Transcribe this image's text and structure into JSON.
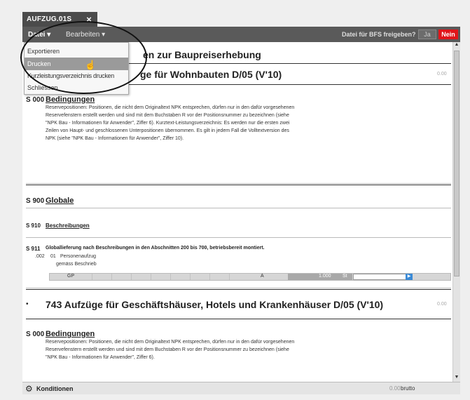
{
  "window": {
    "tab_title": "AUFZUG.01S",
    "tab_close": "×"
  },
  "menubar": {
    "file_menu": "Datei ▾",
    "edit_menu": "Bearbeiten ▾",
    "release_question": "Datei für BFS freigeben?",
    "yes_label": "Ja",
    "no_label": "Nein"
  },
  "dropdown": {
    "items": [
      {
        "label": "Exportieren"
      },
      {
        "label": "Drucken"
      },
      {
        "label": "Kurzleistungsverzeichnis drucken"
      },
      {
        "label": "Schliessen"
      }
    ],
    "active_item": "Drucken"
  },
  "document": {
    "header_partial": "en zur Baupreiserhebung",
    "chapter1_title_partial": "ge für Wohnbauten D/05 (V'10)",
    "chapter1_version": "0.00",
    "s000_code": "S 000",
    "s000_title": "Bedingungen",
    "s000_text": "Reservepositionen: Positionen, die nicht dem Originaltext NPK entsprechen, dürfen nur in den dafür vorgesehenen Reservefenstern erstellt werden und sind mit dem Buchstaben R vor der Positionsnummer zu bezeichnen (siehe \"NPK Bau - Informationen für Anwender\", Ziffer 6). Kurztext-Leistungsverzeichnis: Es werden nur die ersten zwei Zeilen von Haupt- und geschlossenen Unterpositionen übernommen. Es gilt in jedem Fall die Volltextversion des NPK (siehe \"NPK Bau - Informationen für Anwender\", Ziffer 10).",
    "s900_code": "S 900",
    "s900_title": "Globale",
    "s910_code": "S 910",
    "s910_title": "Beschreibungen",
    "s911_code": "S 911",
    "s911_title": "Globallieferung nach Beschreibungen in den Abschnitten 200 bis 700, betriebsbereit montiert.",
    "pos_002_num": ".002",
    "pos_002_sub": "01",
    "pos_002_text": "Personenaufzug",
    "pos_002_text2": "gemäss Beschrieb",
    "grid_gp": "GP",
    "grid_a": "A",
    "grid_qty": "1.000",
    "grid_unit": "St",
    "chapter2_bullet": "•",
    "chapter2_title": "743 Aufzüge für Geschäftshäuser, Hotels und Krankenhäuser D/05 (V'10)",
    "chapter2_version": "0.00",
    "s000b_code": "S 000",
    "s000b_title": "Bedingungen",
    "s000b_text": "Reservepositionen: Positionen, die nicht dem Originaltext NPK entsprechen, dürfen nur in den dafür vorgesehenen Reservefenstern erstellt werden und sind mit dem Buchstaben R vor der Positionsnummer zu bezeichnen (siehe \"NPK Bau - Informationen für Anwender\", Ziffer 6)."
  },
  "footer": {
    "conditions_label": "Konditionen",
    "amount": "0.00",
    "amount_unit": "brutto"
  }
}
